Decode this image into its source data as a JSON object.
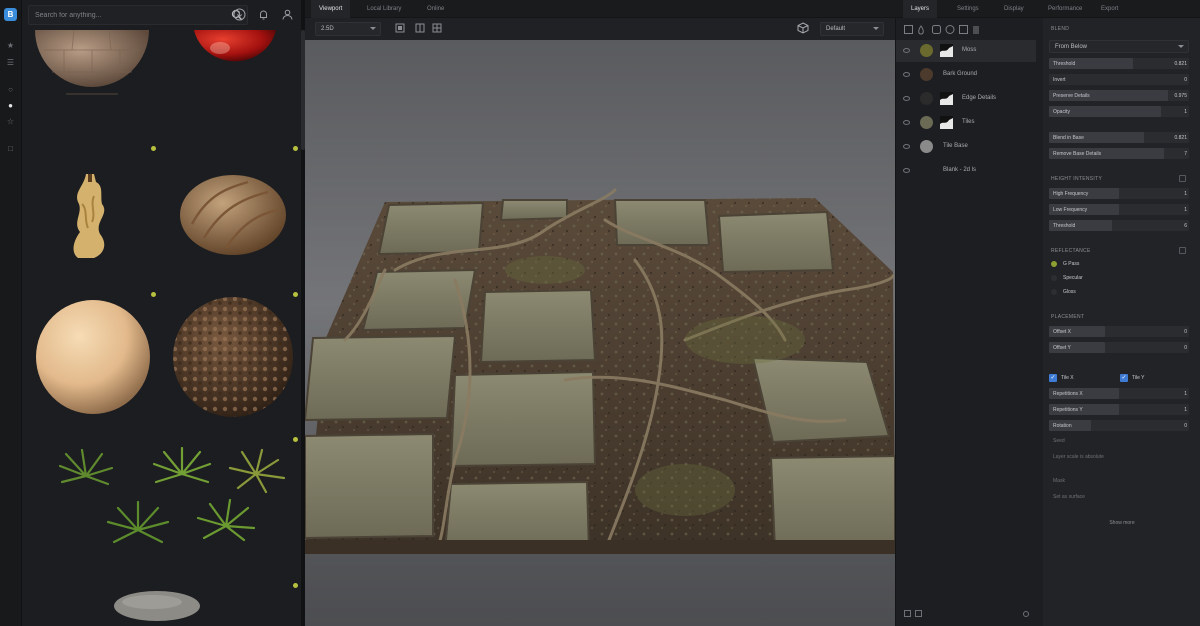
{
  "search": {
    "placeholder": "Search for anything..."
  },
  "viewport_tabs": [
    "Viewport",
    "Local Library",
    "Online"
  ],
  "viewport_toolbar": {
    "display_mode": "2.5D",
    "camera": "Default"
  },
  "right_tabs": [
    "Layers",
    "Settings",
    "Display",
    "Performance",
    "Export"
  ],
  "layers": [
    {
      "name": "Moss",
      "thumb": "#6b6a2e",
      "mask": true,
      "selected": true
    },
    {
      "name": "Bark Ground",
      "thumb": "#4c3a2c",
      "mask": false,
      "selected": false
    },
    {
      "name": "Edge Details",
      "thumb": "#2b2b2b",
      "mask": true,
      "selected": false
    },
    {
      "name": "Tiles",
      "thumb": "#6a6a55",
      "mask": true,
      "selected": false
    },
    {
      "name": "Tile Base",
      "thumb": "#8a8a8a",
      "mask": false,
      "selected": false
    },
    {
      "name": "Blank - 2d ls",
      "thumb": "",
      "mask": false,
      "selected": false
    }
  ],
  "props": {
    "blend_mode": "From Below",
    "main_sliders": [
      {
        "label": "Threshold",
        "value": "0.821",
        "fill": 0.6
      },
      {
        "label": "Invert",
        "value": "0",
        "fill": 0.0
      },
      {
        "label": "Preserve Details",
        "value": "0.975",
        "fill": 0.85
      },
      {
        "label": "Opacity",
        "value": "1",
        "fill": 0.8
      }
    ],
    "base_sliders": [
      {
        "label": "Blend in Base",
        "value": "0.821",
        "fill": 0.68
      },
      {
        "label": "Remove Base Details",
        "value": "7",
        "fill": 0.82
      }
    ],
    "height_section": "HEIGHT INTENSITY",
    "height_sliders": [
      {
        "label": "High Frequency",
        "value": "1",
        "fill": 0.5
      },
      {
        "label": "Low Frequency",
        "value": "1",
        "fill": 0.5
      },
      {
        "label": "Threshold",
        "value": "6",
        "fill": 0.45
      }
    ],
    "channels_section": "REFLECTANCE",
    "channels": [
      {
        "label": "G Pass",
        "color": "#8fa033"
      },
      {
        "label": "Specular",
        "color": "#2d2e31"
      },
      {
        "label": "Gloss",
        "color": "#2d2e31"
      }
    ],
    "placement_section": "PLACEMENT",
    "placement_sliders": [
      {
        "label": "Offset X",
        "value": "0",
        "fill": 0.4
      },
      {
        "label": "Offset Y",
        "value": "0",
        "fill": 0.4
      }
    ],
    "tile_x": "Tile X",
    "tile_y": "Tile Y",
    "repeat_sliders": [
      {
        "label": "Repetitions X",
        "value": "1",
        "fill": 0.5
      },
      {
        "label": "Repetitions Y",
        "value": "1",
        "fill": 0.5
      },
      {
        "label": "Rotation",
        "value": "0",
        "fill": 0.3
      }
    ],
    "seed_label": "Seed",
    "seed_note": "Layer scale is absolute",
    "mask_label": "Mask",
    "mask_note": "Set as surface",
    "show_more": "Show more"
  },
  "colors": {
    "accent": "#3b8edb",
    "favorite_dot": "#b7c13e",
    "check_blue": "#3d7bd4"
  }
}
